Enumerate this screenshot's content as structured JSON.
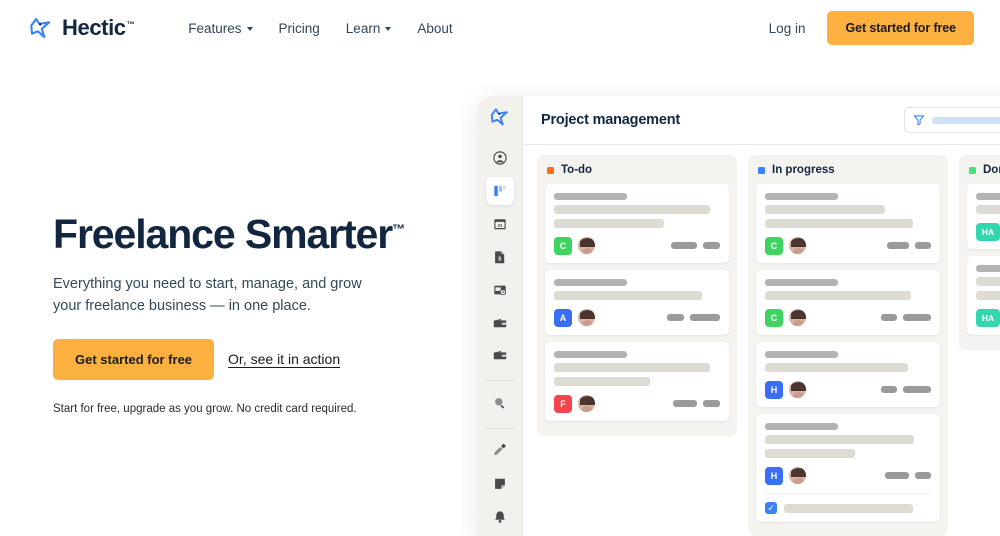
{
  "brand": {
    "name": "Hectic",
    "tm": "™",
    "logo_icon": "hectic-bird-logo"
  },
  "nav": {
    "items": [
      {
        "label": "Features",
        "has_dropdown": true
      },
      {
        "label": "Pricing",
        "has_dropdown": false
      },
      {
        "label": "Learn",
        "has_dropdown": true
      },
      {
        "label": "About",
        "has_dropdown": false
      }
    ],
    "login_label": "Log in",
    "cta_label": "Get started for free"
  },
  "hero": {
    "title": "Freelance Smarter",
    "title_tm": "™",
    "subtitle": "Everything you need to start, manage, and grow your freelance business — in one place.",
    "cta_label": "Get started for free",
    "secondary_link": "Or, see it in action",
    "note": "Start for free, upgrade as you grow. No credit card required."
  },
  "colors": {
    "brand_blue": "#3b82f6",
    "navy": "#12263f",
    "accent_orange": "#fbb040",
    "todo_dot": "#f97316",
    "progress_dot": "#3b82f6",
    "done_dot": "#4ade80"
  },
  "app": {
    "title": "Project management",
    "search_placeholder": "",
    "filter_icon": "filter-funnel-icon",
    "sidebar": {
      "logo_icon": "hectic-bird-logo",
      "items": [
        {
          "icon": "account-circle-icon",
          "active": false
        },
        {
          "icon": "kanban-board-icon",
          "active": true
        },
        {
          "icon": "calendar-31-icon",
          "active": false
        },
        {
          "icon": "invoice-document-icon",
          "active": false
        },
        {
          "icon": "time-tracking-icon",
          "active": false
        },
        {
          "icon": "wallet-icon",
          "active": false
        },
        {
          "icon": "wallet-alt-icon",
          "active": false
        },
        {
          "icon": "search-icon",
          "active": false,
          "after_divider": true
        },
        {
          "icon": "pen-edit-icon",
          "active": false,
          "after_divider": true
        },
        {
          "icon": "notes-page-icon",
          "active": false
        },
        {
          "icon": "bell-notification-icon",
          "active": false
        }
      ]
    },
    "columns": [
      {
        "label": "To-do",
        "dot_color": "#f97316",
        "cards": [
          {
            "title_w": 44,
            "lines": [
              94,
              66
            ],
            "badge": {
              "text": "C",
              "color": "#3fd35f"
            },
            "avatar": true,
            "chips": [
              26,
              17
            ]
          },
          {
            "title_w": 44,
            "lines": [
              89
            ],
            "badge": {
              "text": "A",
              "color": "#3b6ef6"
            },
            "avatar": true,
            "chips": [
              17,
              30
            ]
          },
          {
            "title_w": 44,
            "lines": [
              94,
              58
            ],
            "badge": {
              "text": "F",
              "color": "#f4454f"
            },
            "avatar": true,
            "chips": [
              24,
              17
            ]
          }
        ]
      },
      {
        "label": "In progress",
        "dot_color": "#3b82f6",
        "cards": [
          {
            "title_w": 44,
            "lines": [
              72,
              89
            ],
            "badge": {
              "text": "C",
              "color": "#3fd35f"
            },
            "avatar": true,
            "chips": [
              22,
              16
            ]
          },
          {
            "title_w": 44,
            "lines": [
              88
            ],
            "badge": {
              "text": "C",
              "color": "#3fd35f"
            },
            "avatar": true,
            "chips": [
              16,
              28
            ]
          },
          {
            "title_w": 44,
            "lines": [
              86
            ],
            "badge": {
              "text": "H",
              "color": "#3b6ef6"
            },
            "avatar": true,
            "chips": [
              16,
              28
            ]
          },
          {
            "title_w": 44,
            "lines": [
              90,
              54
            ],
            "badge": {
              "text": "H",
              "color": "#3b6ef6"
            },
            "avatar": true,
            "chips": [
              24,
              16
            ],
            "subtask": {
              "checked": true,
              "line_w": 78
            }
          }
        ]
      },
      {
        "label": "Done",
        "dot_color": "#4ade80",
        "cards": [
          {
            "title_w": 58,
            "lines": [
              90
            ],
            "badge": {
              "text": "HA",
              "color": "#33d6ae"
            },
            "avatar": true,
            "chips": []
          },
          {
            "title_w": 58,
            "lines": [
              90,
              84
            ],
            "badge": {
              "text": "HA",
              "color": "#33d6ae"
            },
            "avatar": true,
            "chips": []
          }
        ]
      }
    ]
  }
}
